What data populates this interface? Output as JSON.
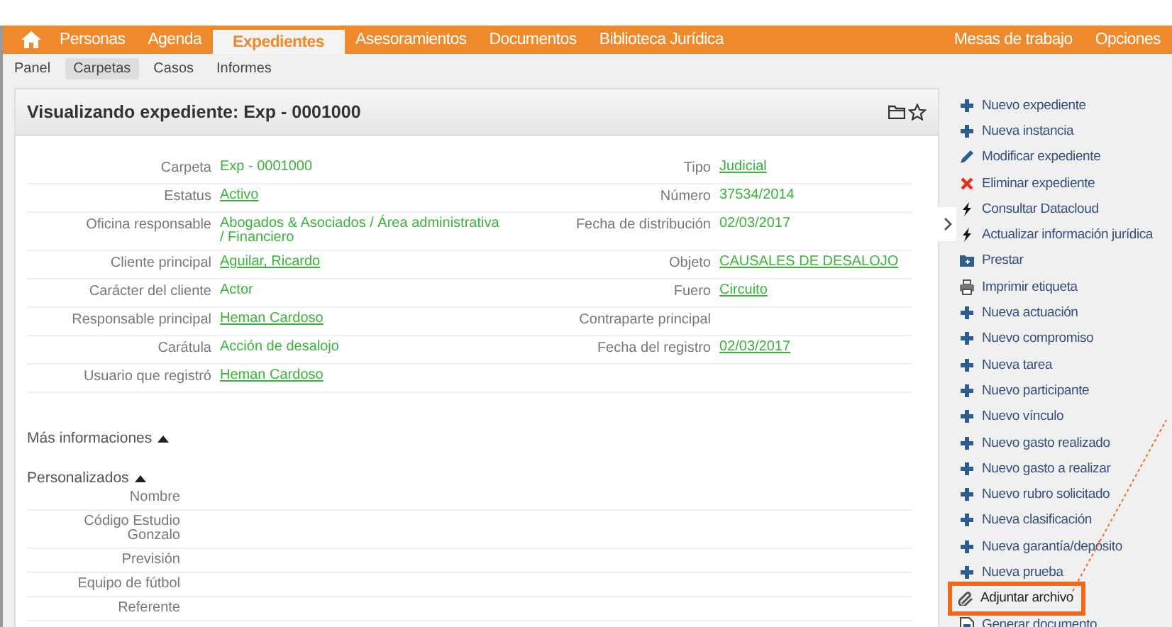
{
  "nav": {
    "items": [
      {
        "label": "Personas",
        "selected": false
      },
      {
        "label": "Agenda",
        "selected": false
      },
      {
        "label": "Expedientes",
        "selected": true
      },
      {
        "label": "Asesoramientos",
        "selected": false
      },
      {
        "label": "Documentos",
        "selected": false
      },
      {
        "label": "Biblioteca Jurídica",
        "selected": false
      }
    ],
    "right_items": [
      {
        "label": "Mesas de trabajo",
        "selected": false
      },
      {
        "label": "Opciones",
        "selected": false
      }
    ]
  },
  "subnav": {
    "items": [
      {
        "label": "Panel",
        "selected": false
      },
      {
        "label": "Carpetas",
        "selected": true
      },
      {
        "label": "Casos",
        "selected": false
      },
      {
        "label": "Informes",
        "selected": false
      }
    ]
  },
  "card": {
    "title": "Visualizando expediente: Exp - 0001000",
    "rows": [
      {
        "left": {
          "label": "Carpeta",
          "value": "Exp - 0001000",
          "link": false
        },
        "right": {
          "label": "Tipo",
          "value": "Judicial",
          "link": true
        }
      },
      {
        "left": {
          "label": "Estatus",
          "value": "Activo",
          "link": true
        },
        "right": {
          "label": "Número",
          "value": "37534/2014",
          "link": false
        }
      },
      {
        "left": {
          "label": "Oficina responsable",
          "value": "Abogados & Asociados / Área administrativa / Financiero",
          "link": false
        },
        "right": {
          "label": "Fecha de distribución",
          "value": "02/03/2017",
          "link": false
        }
      },
      {
        "left": {
          "label": "Cliente principal",
          "value": "Aguilar, Ricardo",
          "link": true
        },
        "right": {
          "label": "Objeto",
          "value": "CAUSALES DE DESALOJO",
          "link": true
        }
      },
      {
        "left": {
          "label": "Carácter del cliente",
          "value": "Actor",
          "link": false
        },
        "right": {
          "label": "Fuero",
          "value": "Circuito",
          "link": true
        }
      },
      {
        "left": {
          "label": "Responsable principal",
          "value": "Heman Cardoso",
          "link": true
        },
        "right": {
          "label": "Contraparte principal"
        }
      },
      {
        "left": {
          "label": "Carátula",
          "value": "Acción de desalojo",
          "link": false
        },
        "right": {
          "label": "Fecha del registro",
          "value": "02/03/2017",
          "link": true
        }
      },
      {
        "left": {
          "label": "Usuario que registró",
          "value": "Heman Cardoso",
          "link": true
        }
      }
    ],
    "sections": [
      {
        "title": "Más informaciones",
        "expanded": true
      },
      {
        "title": "Personalizados",
        "expanded": true,
        "fields": [
          "Nombre",
          "Código Estudio Gonzalo",
          "Previsión",
          "Equipo de fútbol",
          "Referente"
        ]
      }
    ]
  },
  "actions": [
    {
      "label": "Nuevo expediente",
      "kind": "plus",
      "highlighted": false
    },
    {
      "label": "Nueva instancia",
      "kind": "plus",
      "highlighted": false
    },
    {
      "label": "Modificar expediente",
      "kind": "pencil",
      "highlighted": false
    },
    {
      "label": "Eliminar expediente",
      "kind": "cross",
      "highlighted": false
    },
    {
      "label": "Consultar Datacloud",
      "kind": "bolt",
      "highlighted": false
    },
    {
      "label": "Actualizar información jurídica",
      "kind": "bolt",
      "highlighted": false
    },
    {
      "label": "Prestar",
      "kind": "folder",
      "highlighted": false
    },
    {
      "label": "Imprimir etiqueta",
      "kind": "printer",
      "highlighted": false
    },
    {
      "label": "Nueva actuación",
      "kind": "plus",
      "highlighted": false
    },
    {
      "label": "Nuevo compromiso",
      "kind": "plus",
      "highlighted": false
    },
    {
      "label": "Nueva tarea",
      "kind": "plus",
      "highlighted": false
    },
    {
      "label": "Nuevo participante",
      "kind": "plus",
      "highlighted": false
    },
    {
      "label": "Nuevo vínculo",
      "kind": "plus",
      "highlighted": false
    },
    {
      "label": "Nuevo gasto realizado",
      "kind": "plus",
      "highlighted": false
    },
    {
      "label": "Nuevo gasto a realizar",
      "kind": "plus",
      "highlighted": false
    },
    {
      "label": "Nuevo rubro solicitado",
      "kind": "plus",
      "highlighted": false
    },
    {
      "label": "Nueva clasificación",
      "kind": "plus",
      "highlighted": false
    },
    {
      "label": "Nueva garantía/depósito",
      "kind": "plus",
      "highlighted": false
    },
    {
      "label": "Nueva prueba",
      "kind": "plus",
      "highlighted": false
    },
    {
      "label": "Adjuntar archivo",
      "kind": "clip",
      "highlighted": true
    },
    {
      "label": "Generar documento",
      "kind": "document",
      "highlighted": false
    }
  ]
}
